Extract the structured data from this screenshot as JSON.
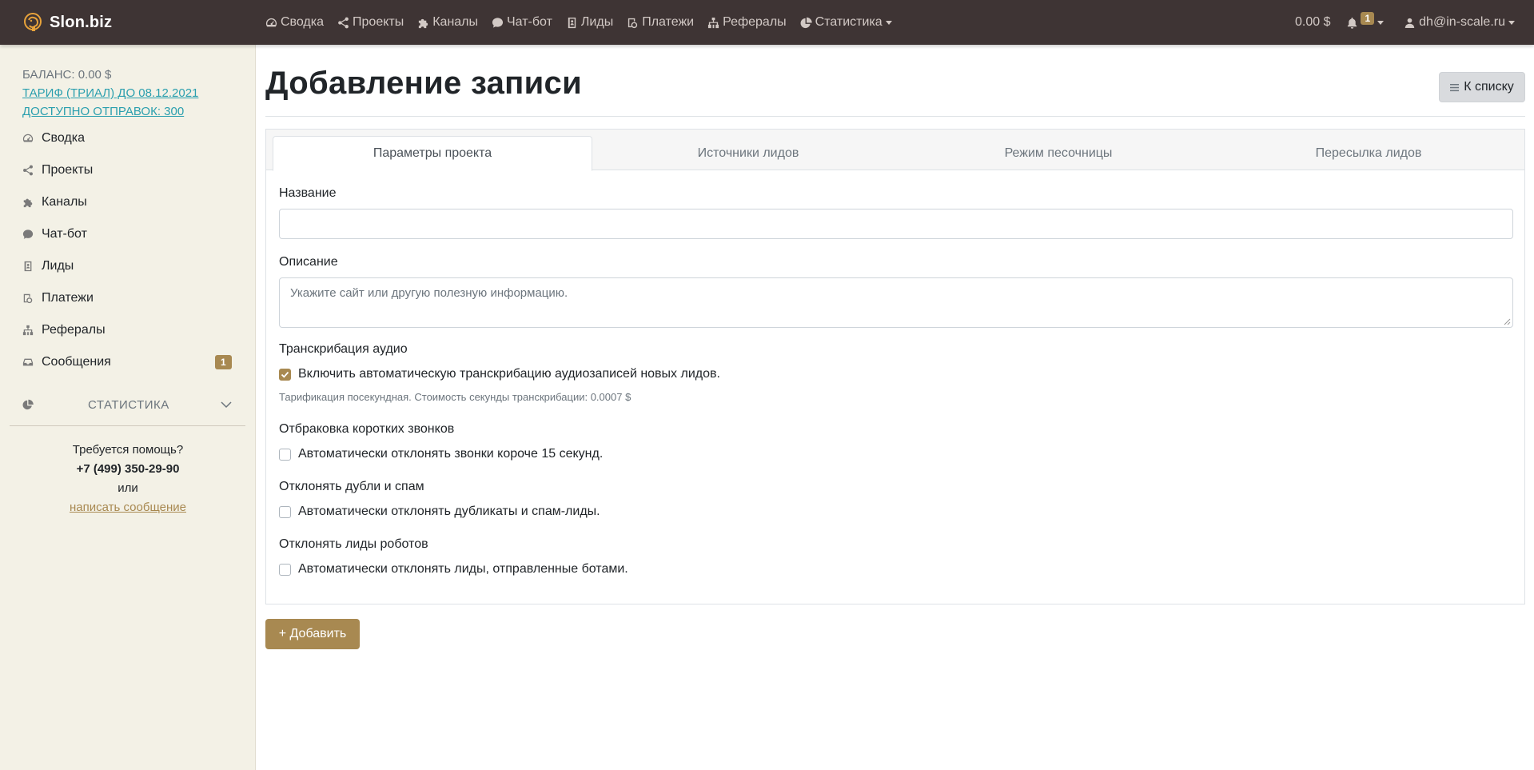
{
  "brand": {
    "name": "Slon.biz"
  },
  "topnav": {
    "items": [
      {
        "label": "Сводка",
        "icon": "dashboard-icon"
      },
      {
        "label": "Проекты",
        "icon": "share-icon"
      },
      {
        "label": "Каналы",
        "icon": "puzzle-icon"
      },
      {
        "label": "Чат-бот",
        "icon": "chat-icon"
      },
      {
        "label": "Лиды",
        "icon": "contact-book-icon"
      },
      {
        "label": "Платежи",
        "icon": "money-icon"
      },
      {
        "label": "Рефералы",
        "icon": "sitemap-icon"
      },
      {
        "label": "Статистика",
        "icon": "pie-chart-icon"
      }
    ],
    "balance": "0.00 $",
    "notifications_count": "1",
    "user_email": "dh@in-scale.ru"
  },
  "sidebar": {
    "balance_label": "БАЛАНС: 0.00 $",
    "tariff_link": "ТАРИФ (ТРИАЛ) ДО 08.12.2021",
    "sends_link": "ДОСТУПНО ОТПРАВОК: 300",
    "items": [
      {
        "label": "Сводка",
        "icon": "dashboard-icon"
      },
      {
        "label": "Проекты",
        "icon": "share-icon"
      },
      {
        "label": "Каналы",
        "icon": "puzzle-icon"
      },
      {
        "label": "Чат-бот",
        "icon": "chat-icon"
      },
      {
        "label": "Лиды",
        "icon": "contact-book-icon"
      },
      {
        "label": "Платежи",
        "icon": "money-icon"
      },
      {
        "label": "Рефералы",
        "icon": "sitemap-icon"
      },
      {
        "label": "Сообщения",
        "icon": "inbox-icon",
        "badge": "1"
      }
    ],
    "stats_label": "СТАТИСТИКА",
    "help": {
      "title": "Требуется помощь?",
      "phone": "+7 (499) 350-29-90",
      "or": "или",
      "link": "написать сообщение"
    }
  },
  "main": {
    "title": "Добавление записи",
    "back_button": "К списку",
    "tabs": [
      "Параметры проекта",
      "Источники лидов",
      "Режим песочницы",
      "Пересылка лидов"
    ],
    "form": {
      "name_label": "Название",
      "name_value": "",
      "description_label": "Описание",
      "description_placeholder": "Укажите сайт или другую полезную информацию.",
      "transcription_label": "Транскрибация аудио",
      "transcription_checkbox": "Включить автоматическую транскрибацию аудиозаписей новых лидов.",
      "transcription_checked": true,
      "transcription_hint": "Тарификация посекундная. Стоимость секунды транскрибации: 0.0007 $",
      "short_calls_label": "Отбраковка коротких звонков",
      "short_calls_checkbox": "Автоматически отклонять звонки короче 15 секунд.",
      "dupes_label": "Отклонять дубли и спам",
      "dupes_checkbox": "Автоматически отклонять дубликаты и спам-лиды.",
      "robots_label": "Отклонять лиды роботов",
      "robots_checkbox": "Автоматически отклонять лиды, отправленные ботами."
    },
    "submit_button": "+ Добавить"
  },
  "colors": {
    "navbar": "#3e3434",
    "accent": "#a88951",
    "sidebar": "#f3f1e6",
    "link": "#2a9fae"
  }
}
